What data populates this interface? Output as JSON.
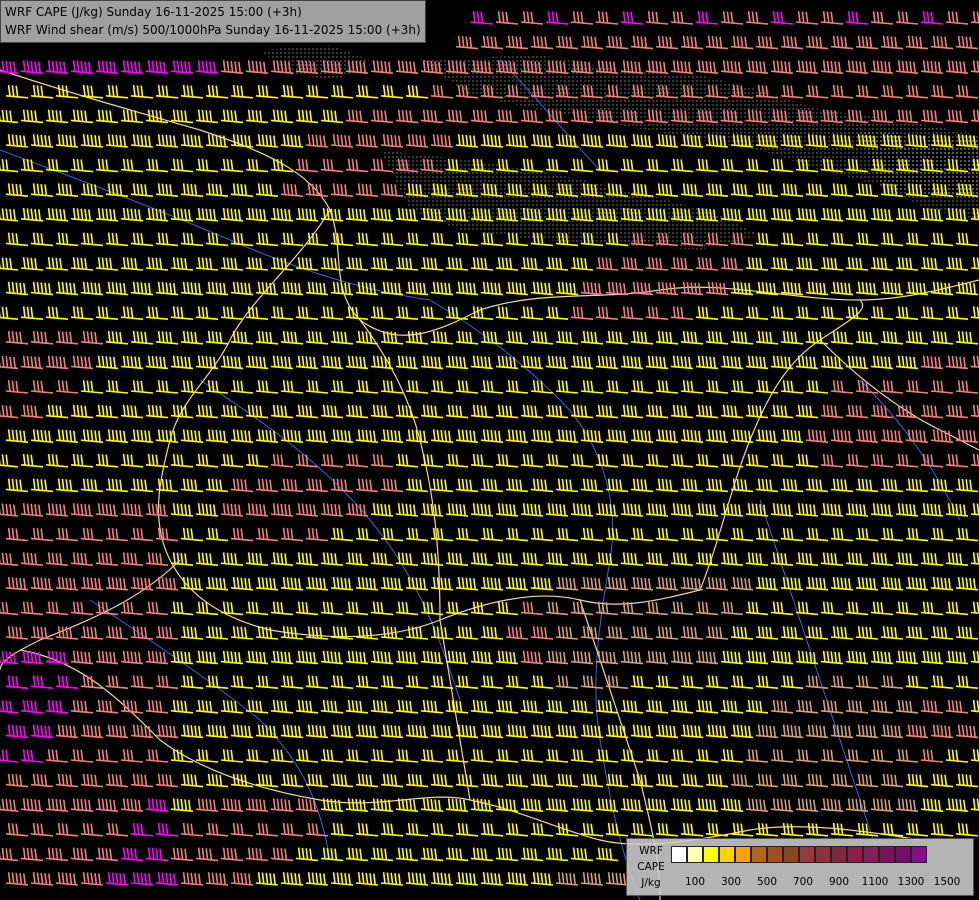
{
  "header": {
    "line1": "WRF CAPE (J/kg) Sunday 16-11-2025 15:00 (+3h)",
    "line2": "WRF Wind shear (m/s) 500/1000hPa Sunday 16-11-2025 15:00 (+3h)"
  },
  "legend": {
    "names": [
      "WRF",
      "CAPE",
      "J/kg"
    ],
    "tick_labels": [
      "100",
      "300",
      "500",
      "700",
      "900",
      "1100",
      "1300",
      "1500"
    ],
    "swatch_colors": [
      "#ffffff",
      "#ffffb4",
      "#ffff00",
      "#ffd200",
      "#ffa000",
      "#b4641e",
      "#a0501e",
      "#8c461e",
      "#963c3c",
      "#8c323c",
      "#82283c",
      "#8c1e4b",
      "#821e5a",
      "#78145a",
      "#780a6e",
      "#8c0a8c"
    ]
  },
  "colors": {
    "background": "#000000",
    "barb_yellow": "#ffff00",
    "barb_salmon": "#f08080",
    "barb_magenta": "#ff00ff",
    "barb_tan": "#d2a07a",
    "border_line": "#f0d7a0",
    "river": "#3c64dc",
    "coast_dots": "#ffffff"
  },
  "icons": [
    "wind-barb-icon"
  ]
}
